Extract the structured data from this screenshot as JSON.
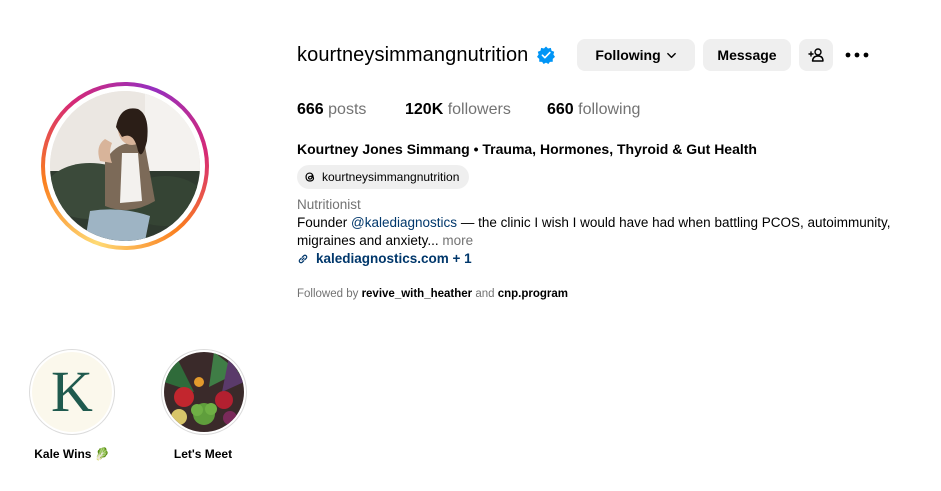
{
  "profile": {
    "username": "kourtneysimmangnutrition",
    "verified_icon": "verified-badge-icon",
    "full_name": "Kourtney Jones Simmang • Trauma, Hormones, Thyroid & Gut Health",
    "threads_handle": "kourtneysimmangnutrition",
    "category": "Nutritionist",
    "bio_prefix": "Founder ",
    "bio_mention": "@kalediagnostics",
    "bio_rest_line1": " — the clinic I wish I would have had when battling PCOS, autoimmunity,",
    "bio_rest_line2": "migraines and anxiety...",
    "bio_more": "more",
    "link": "kalediagnostics.com + 1",
    "followed_by_prefix": "Followed by ",
    "followed_by_user1": "revive_with_heather",
    "followed_by_and": " and ",
    "followed_by_user2": "cnp.program"
  },
  "actions": {
    "following_label": "Following",
    "message_label": "Message",
    "add_icon": "add-person-icon",
    "more_icon": "more-options-icon"
  },
  "stats": {
    "posts_count": "666",
    "posts_label": " posts",
    "followers_count": "120K",
    "followers_label": " followers",
    "following_count": "660",
    "following_label": " following"
  },
  "highlights": [
    {
      "label": "Kale Wins 🥬",
      "letter": "K"
    },
    {
      "label": "Let's Meet"
    }
  ],
  "colors": {
    "link_blue": "#00376b",
    "verified_blue": "#0095f6",
    "button_gray": "#efefef",
    "muted_text": "#737373",
    "kale_green": "#1f5a4e"
  }
}
